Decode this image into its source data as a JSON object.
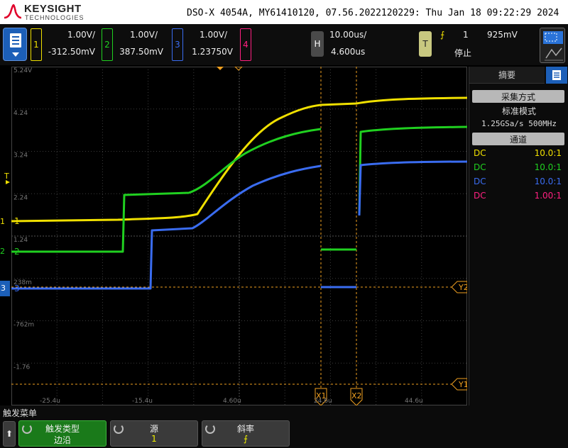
{
  "brand": {
    "name": "KEYSIGHT",
    "sub": "TECHNOLOGIES"
  },
  "instrument_info": "DSO-X 4054A, MY61410120, 07.56.2022120229: Thu Jan 18 09:22:29 2024",
  "channels": [
    {
      "num": "1",
      "scale": "1.00V/",
      "offset": "-312.50mV",
      "color": "#f0e000"
    },
    {
      "num": "2",
      "scale": "1.00V/",
      "offset": "387.50mV",
      "color": "#20d020"
    },
    {
      "num": "3",
      "scale": "1.00V/",
      "offset": "1.23750V",
      "color": "#3a6cf0"
    },
    {
      "num": "4",
      "scale": "",
      "offset": "",
      "color": "#ff2080"
    }
  ],
  "horizontal": {
    "label": "H",
    "scale": "10.00us/",
    "delay": "4.600us"
  },
  "trigger": {
    "label": "T",
    "source": "1",
    "level": "925mV",
    "status": "停止",
    "slope_symbol": "⨍"
  },
  "grid_labels": {
    "y": [
      "5.24V",
      "4.24",
      "3.24",
      "2.24",
      "1.24",
      "238m",
      "-762m",
      "-1.76"
    ],
    "x": [
      "-25.4u",
      "-15.4u",
      "4.60u",
      "24.6u",
      "44.6u"
    ]
  },
  "markers": {
    "ch1": "1",
    "ch2": "2",
    "ch3": "3",
    "trigger": "T",
    "y1": "Y1",
    "y2": "Y2",
    "x1": "X1",
    "x2": "X2"
  },
  "side_panel": {
    "tab": "摘要",
    "acq_header": "采集方式",
    "acq_mode": "标准模式",
    "acq_rate": "1.25GSa/s  500MHz",
    "chan_header": "通道",
    "rows": [
      {
        "coupling": "DC",
        "probe": "10.0:1"
      },
      {
        "coupling": "DC",
        "probe": "10.0:1"
      },
      {
        "coupling": "DC",
        "probe": "10.0:1"
      },
      {
        "coupling": "DC",
        "probe": "1.00:1"
      }
    ]
  },
  "softkeys": {
    "menu_title": "触发菜单",
    "home": "⬆",
    "keys": [
      {
        "label": "触发类型",
        "value": "边沿"
      },
      {
        "label": "源",
        "value": "1"
      },
      {
        "label": "斜率",
        "value": "⨍"
      }
    ]
  },
  "colors": {
    "ch1": "#f0e000",
    "ch2": "#20d020",
    "ch3": "#3a6cf0",
    "ch4": "#ff2080",
    "marker": "#f0a020",
    "grid": "#3c3c3c"
  }
}
